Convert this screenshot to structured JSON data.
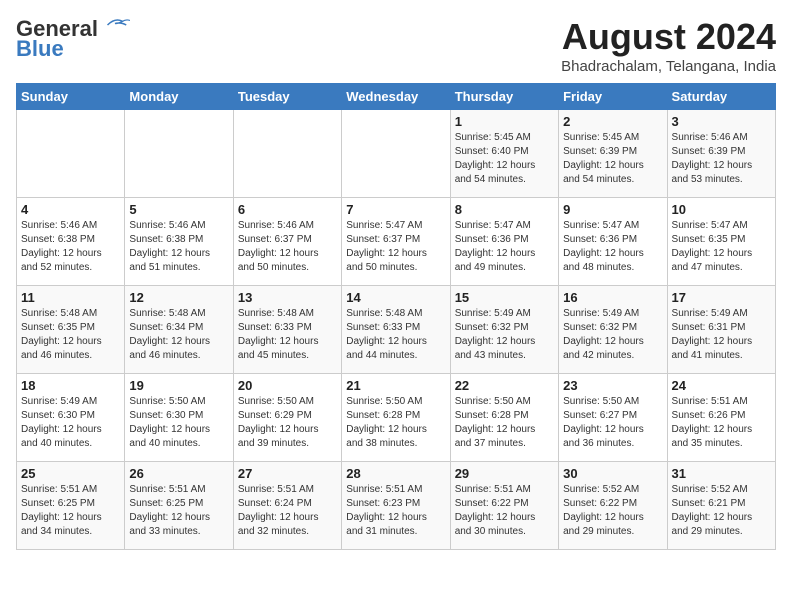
{
  "header": {
    "logo_general": "General",
    "logo_blue": "Blue",
    "month_year": "August 2024",
    "location": "Bhadrachalam, Telangana, India"
  },
  "weekdays": [
    "Sunday",
    "Monday",
    "Tuesday",
    "Wednesday",
    "Thursday",
    "Friday",
    "Saturday"
  ],
  "weeks": [
    [
      {
        "day": "",
        "content": ""
      },
      {
        "day": "",
        "content": ""
      },
      {
        "day": "",
        "content": ""
      },
      {
        "day": "",
        "content": ""
      },
      {
        "day": "1",
        "content": "Sunrise: 5:45 AM\nSunset: 6:40 PM\nDaylight: 12 hours\nand 54 minutes."
      },
      {
        "day": "2",
        "content": "Sunrise: 5:45 AM\nSunset: 6:39 PM\nDaylight: 12 hours\nand 54 minutes."
      },
      {
        "day": "3",
        "content": "Sunrise: 5:46 AM\nSunset: 6:39 PM\nDaylight: 12 hours\nand 53 minutes."
      }
    ],
    [
      {
        "day": "4",
        "content": "Sunrise: 5:46 AM\nSunset: 6:38 PM\nDaylight: 12 hours\nand 52 minutes."
      },
      {
        "day": "5",
        "content": "Sunrise: 5:46 AM\nSunset: 6:38 PM\nDaylight: 12 hours\nand 51 minutes."
      },
      {
        "day": "6",
        "content": "Sunrise: 5:46 AM\nSunset: 6:37 PM\nDaylight: 12 hours\nand 50 minutes."
      },
      {
        "day": "7",
        "content": "Sunrise: 5:47 AM\nSunset: 6:37 PM\nDaylight: 12 hours\nand 50 minutes."
      },
      {
        "day": "8",
        "content": "Sunrise: 5:47 AM\nSunset: 6:36 PM\nDaylight: 12 hours\nand 49 minutes."
      },
      {
        "day": "9",
        "content": "Sunrise: 5:47 AM\nSunset: 6:36 PM\nDaylight: 12 hours\nand 48 minutes."
      },
      {
        "day": "10",
        "content": "Sunrise: 5:47 AM\nSunset: 6:35 PM\nDaylight: 12 hours\nand 47 minutes."
      }
    ],
    [
      {
        "day": "11",
        "content": "Sunrise: 5:48 AM\nSunset: 6:35 PM\nDaylight: 12 hours\nand 46 minutes."
      },
      {
        "day": "12",
        "content": "Sunrise: 5:48 AM\nSunset: 6:34 PM\nDaylight: 12 hours\nand 46 minutes."
      },
      {
        "day": "13",
        "content": "Sunrise: 5:48 AM\nSunset: 6:33 PM\nDaylight: 12 hours\nand 45 minutes."
      },
      {
        "day": "14",
        "content": "Sunrise: 5:48 AM\nSunset: 6:33 PM\nDaylight: 12 hours\nand 44 minutes."
      },
      {
        "day": "15",
        "content": "Sunrise: 5:49 AM\nSunset: 6:32 PM\nDaylight: 12 hours\nand 43 minutes."
      },
      {
        "day": "16",
        "content": "Sunrise: 5:49 AM\nSunset: 6:32 PM\nDaylight: 12 hours\nand 42 minutes."
      },
      {
        "day": "17",
        "content": "Sunrise: 5:49 AM\nSunset: 6:31 PM\nDaylight: 12 hours\nand 41 minutes."
      }
    ],
    [
      {
        "day": "18",
        "content": "Sunrise: 5:49 AM\nSunset: 6:30 PM\nDaylight: 12 hours\nand 40 minutes."
      },
      {
        "day": "19",
        "content": "Sunrise: 5:50 AM\nSunset: 6:30 PM\nDaylight: 12 hours\nand 40 minutes."
      },
      {
        "day": "20",
        "content": "Sunrise: 5:50 AM\nSunset: 6:29 PM\nDaylight: 12 hours\nand 39 minutes."
      },
      {
        "day": "21",
        "content": "Sunrise: 5:50 AM\nSunset: 6:28 PM\nDaylight: 12 hours\nand 38 minutes."
      },
      {
        "day": "22",
        "content": "Sunrise: 5:50 AM\nSunset: 6:28 PM\nDaylight: 12 hours\nand 37 minutes."
      },
      {
        "day": "23",
        "content": "Sunrise: 5:50 AM\nSunset: 6:27 PM\nDaylight: 12 hours\nand 36 minutes."
      },
      {
        "day": "24",
        "content": "Sunrise: 5:51 AM\nSunset: 6:26 PM\nDaylight: 12 hours\nand 35 minutes."
      }
    ],
    [
      {
        "day": "25",
        "content": "Sunrise: 5:51 AM\nSunset: 6:25 PM\nDaylight: 12 hours\nand 34 minutes."
      },
      {
        "day": "26",
        "content": "Sunrise: 5:51 AM\nSunset: 6:25 PM\nDaylight: 12 hours\nand 33 minutes."
      },
      {
        "day": "27",
        "content": "Sunrise: 5:51 AM\nSunset: 6:24 PM\nDaylight: 12 hours\nand 32 minutes."
      },
      {
        "day": "28",
        "content": "Sunrise: 5:51 AM\nSunset: 6:23 PM\nDaylight: 12 hours\nand 31 minutes."
      },
      {
        "day": "29",
        "content": "Sunrise: 5:51 AM\nSunset: 6:22 PM\nDaylight: 12 hours\nand 30 minutes."
      },
      {
        "day": "30",
        "content": "Sunrise: 5:52 AM\nSunset: 6:22 PM\nDaylight: 12 hours\nand 29 minutes."
      },
      {
        "day": "31",
        "content": "Sunrise: 5:52 AM\nSunset: 6:21 PM\nDaylight: 12 hours\nand 29 minutes."
      }
    ]
  ]
}
